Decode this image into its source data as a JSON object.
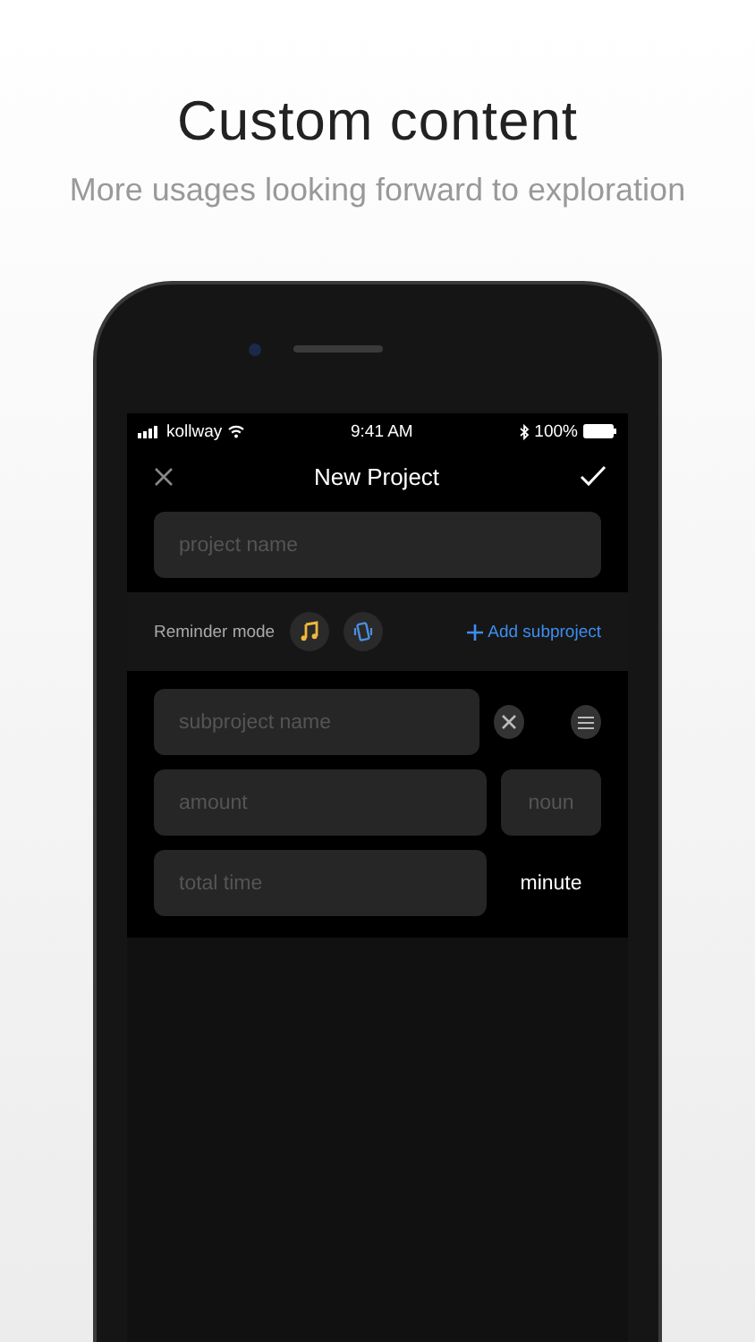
{
  "headline": "Custom content",
  "subtitle": "More usages looking forward to exploration",
  "status_bar": {
    "carrier": "kollway",
    "time": "9:41 AM",
    "battery": "100%"
  },
  "nav": {
    "title": "New Project"
  },
  "project_field": {
    "placeholder": "project name"
  },
  "reminder": {
    "label": "Reminder mode",
    "modes": [
      {
        "kind": "sound",
        "selected": true
      },
      {
        "kind": "vibrate",
        "selected": true
      }
    ],
    "add_link": "Add subproject"
  },
  "subproject": {
    "name_field": {
      "placeholder": "subproject name"
    },
    "amount_field": {
      "placeholder": "amount"
    },
    "unit_field": {
      "placeholder": "noun"
    },
    "time_field": {
      "placeholder": "total time"
    },
    "time_unit": "minute"
  }
}
